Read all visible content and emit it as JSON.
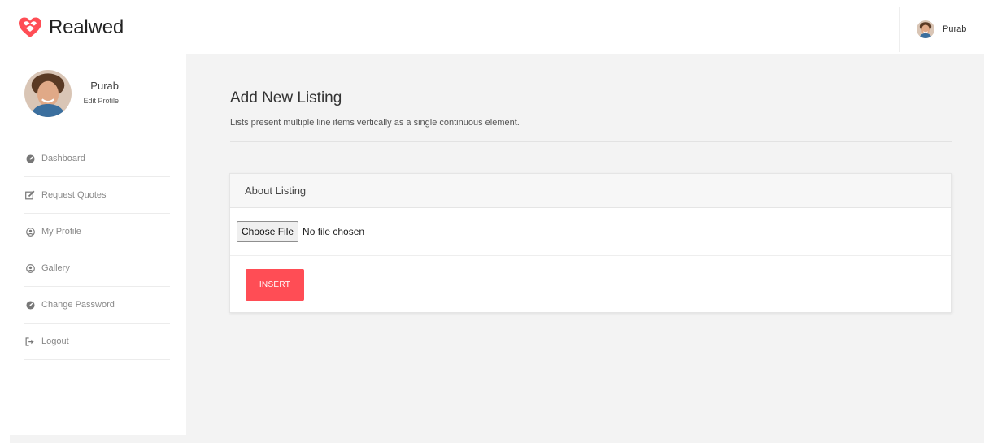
{
  "app": {
    "brand": "Realwed",
    "accent_color": "#ff4d55",
    "logo_icon": "heart-icon"
  },
  "header": {
    "user_name": "Purab",
    "avatar_icon": "avatar"
  },
  "sidebar": {
    "profile": {
      "name": "Purab",
      "edit_label": "Edit Profile"
    },
    "items": [
      {
        "label": "Dashboard",
        "icon": "dashboard-icon"
      },
      {
        "label": "Request Quotes",
        "icon": "edit-icon"
      },
      {
        "label": "My Profile",
        "icon": "user-circle-icon"
      },
      {
        "label": "Gallery",
        "icon": "user-circle-icon"
      },
      {
        "label": "Change Password",
        "icon": "dashboard-icon"
      },
      {
        "label": "Logout",
        "icon": "sign-out-icon"
      }
    ]
  },
  "main": {
    "title": "Add New Listing",
    "subtitle": "Lists present multiple line items vertically as a single continuous element.",
    "card": {
      "title": "About Listing",
      "file_button_label": "Choose File",
      "file_status": "No file chosen",
      "submit_label": "INSERT"
    }
  }
}
